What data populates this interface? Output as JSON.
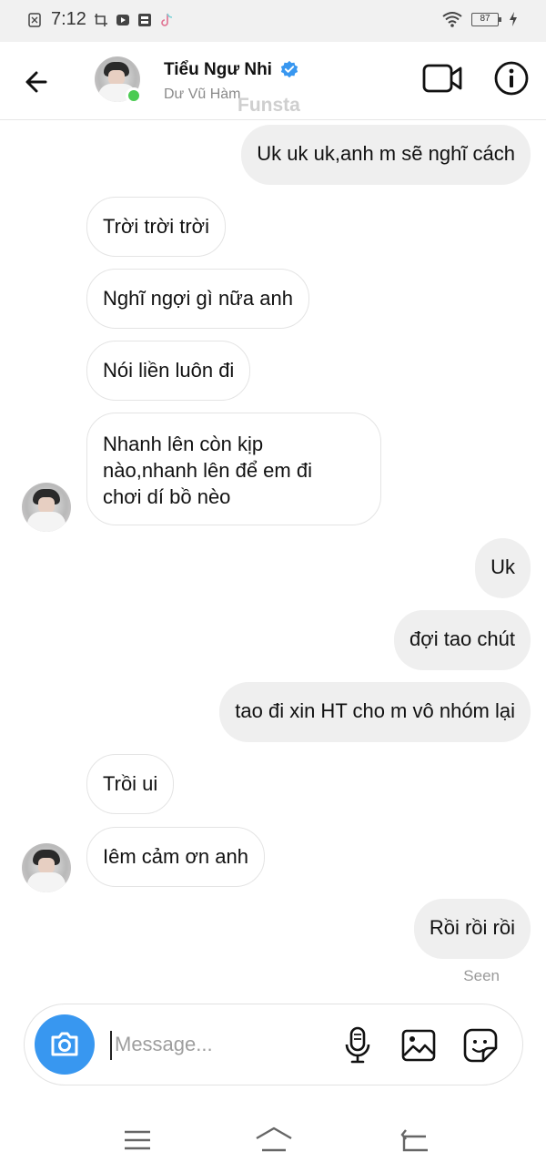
{
  "status_bar": {
    "time": "7:12",
    "battery": "87",
    "icons": [
      "sim-icon",
      "screenshot-icon",
      "youtube-icon",
      "app-icon",
      "tiktok-icon",
      "wifi-icon",
      "battery-icon",
      "charging-icon"
    ]
  },
  "header": {
    "contact_name": "Tiểu Ngư Nhi",
    "contact_username": "Dư Vũ Hàm",
    "watermark": "Funsta",
    "verified": true,
    "online": true
  },
  "messages": [
    {
      "direction": "out",
      "text": "Uk uk uk,anh m sẽ nghĩ cách"
    },
    {
      "direction": "in",
      "text": "Trời trời trời"
    },
    {
      "direction": "in",
      "text": "Nghĩ ngợi gì nữa anh"
    },
    {
      "direction": "in",
      "text": "Nói liền luôn đi"
    },
    {
      "direction": "in",
      "lines": [
        "Nhanh lên còn kịp",
        "nào,nhanh lên để em đi",
        "chơi dí bồ nèo"
      ]
    },
    {
      "direction": "out",
      "text": "Uk"
    },
    {
      "direction": "out",
      "text": "đợi tao chút"
    },
    {
      "direction": "out",
      "text": "tao đi xin HT cho m vô nhóm lại"
    },
    {
      "direction": "in",
      "text": "Trồi ui"
    },
    {
      "direction": "in",
      "text": "Iêm cảm ơn anh"
    },
    {
      "direction": "out",
      "text": "Rồi rồi rồi"
    }
  ],
  "seen_label": "Seen",
  "composer": {
    "placeholder": "Message..."
  },
  "colors": {
    "accent": "#3897f0",
    "online": "#4bcb52",
    "outgoing_bubble": "#efefef",
    "incoming_border": "#e4e4e4"
  }
}
